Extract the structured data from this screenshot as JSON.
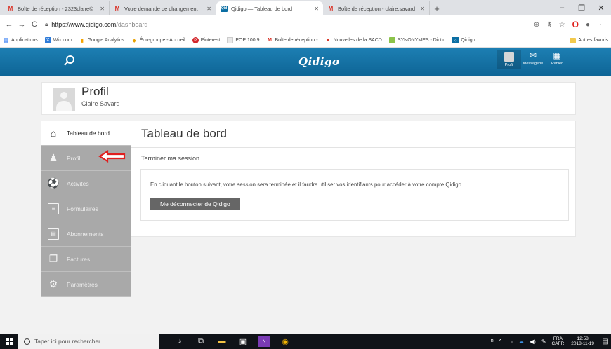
{
  "browser": {
    "tabs": [
      {
        "title": "Boîte de réception - 2323claire©",
        "icon": "gmail-icon",
        "active": false
      },
      {
        "title": "Votre demande de changement",
        "icon": "gmail-icon",
        "active": false
      },
      {
        "title": "Qidigo — Tableau de bord",
        "icon": "qidigo-icon",
        "active": true
      },
      {
        "title": "Boîte de réception - claire.savard",
        "icon": "gmail-icon",
        "active": false
      }
    ],
    "url_host": "https://www.qidigo.com",
    "url_path": "/dashboard",
    "bookmarks": [
      {
        "label": "Applications",
        "cls": "bm-apps",
        "glyph": "▦"
      },
      {
        "label": "Wix.com",
        "cls": "bm-wix",
        "glyph": "X"
      },
      {
        "label": "Google Analytics",
        "cls": "bm-ga",
        "glyph": "▮"
      },
      {
        "label": "Édu-groupe - Accueil",
        "cls": "bm-edu",
        "glyph": "◆"
      },
      {
        "label": "Pinterest",
        "cls": "bm-pin",
        "glyph": "P"
      },
      {
        "label": "POP 100.9",
        "cls": "bm-pop",
        "glyph": ""
      },
      {
        "label": "Boîte de réception -",
        "cls": "bm-gm",
        "glyph": "M"
      },
      {
        "label": "Nouvelles de la SACD",
        "cls": "bm-sacd",
        "glyph": "●"
      },
      {
        "label": "SYNONYMES - Dictio",
        "cls": "bm-syn",
        "glyph": ""
      },
      {
        "label": "Qidigo",
        "cls": "bm-qid",
        "glyph": "Q"
      }
    ],
    "other_bookmarks": "Autres favoris"
  },
  "site": {
    "logo": "Qidigo",
    "nav": [
      {
        "label": "Profil",
        "glyph": ""
      },
      {
        "label": "Messagerie",
        "glyph": "✉"
      },
      {
        "label": "Panier",
        "glyph": "▦"
      }
    ]
  },
  "profile": {
    "title": "Profil",
    "name": "Claire Savard"
  },
  "sidebar": {
    "items": [
      {
        "label": "Tableau de bord",
        "icon": "home-icon",
        "glyph": "⌂",
        "active": true
      },
      {
        "label": "Profil",
        "icon": "person-icon",
        "glyph": "♟",
        "active": false
      },
      {
        "label": "Activités",
        "icon": "activities-icon",
        "glyph": "⚽",
        "active": false
      },
      {
        "label": "Formulaires",
        "icon": "form-icon",
        "glyph": "≡",
        "active": false,
        "box": true
      },
      {
        "label": "Abonnements",
        "icon": "subscription-icon",
        "glyph": "▤",
        "active": false,
        "box": true
      },
      {
        "label": "Factures",
        "icon": "invoice-icon",
        "glyph": "❐",
        "active": false
      },
      {
        "label": "Paramètres",
        "icon": "settings-icon",
        "glyph": "⚙",
        "active": false
      }
    ]
  },
  "main": {
    "title": "Tableau de bord",
    "subtitle": "Terminer ma session",
    "message": "En cliquant le bouton suivant, votre session sera terminée et il faudra utiliser vos identifiants pour accéder à votre compte Qidigo.",
    "logout_button": "Me déconnecter de Qidigo"
  },
  "taskbar": {
    "search_placeholder": "Taper ici pour rechercher",
    "lang_line1": "FRA",
    "lang_line2": "CAFR",
    "time": "12:58",
    "date": "2018-11-19"
  },
  "colors": {
    "header": "#0e6596",
    "sidebar": "#a9a9a9",
    "arrow": "#e01e1e",
    "button": "#666666"
  }
}
